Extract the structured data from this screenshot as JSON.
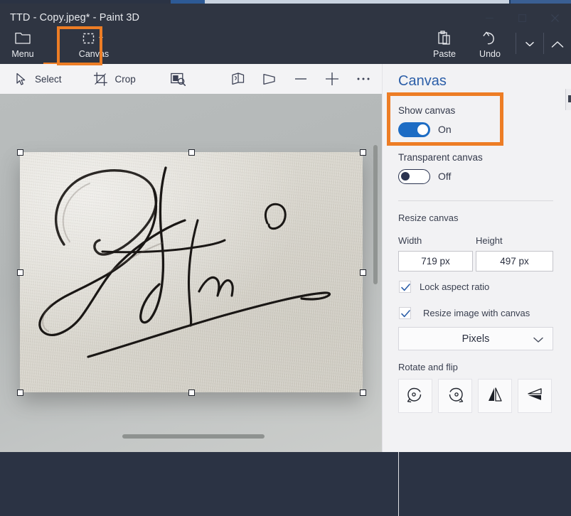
{
  "window": {
    "title": "TTD - Copy.jpeg* - Paint 3D",
    "minimize_label": "Minimize",
    "maximize_label": "Maximize",
    "close_label": "Close"
  },
  "ribbon": {
    "items": [
      {
        "label": "Menu",
        "icon": "folder-icon"
      },
      {
        "label": "Canvas",
        "icon": "canvas-icon",
        "highlighted": true,
        "has_dropdown": true
      }
    ],
    "right_items": [
      {
        "label": "Paste",
        "icon": "clipboard-icon"
      },
      {
        "label": "Undo",
        "icon": "undo-icon"
      }
    ],
    "more_label": "More options",
    "collapse_label": "Collapse ribbon",
    "highlight_color": "#ed7d25"
  },
  "toolbar": {
    "select_label": "Select",
    "crop_label": "Crop",
    "magic_select_label": "Magic select",
    "view3d_label": "3D view",
    "perspective_label": "Perspective",
    "zoom_out_label": "Zoom out",
    "zoom_in_label": "Zoom in",
    "more_label": "More"
  },
  "panel": {
    "title": "Canvas",
    "show_canvas": {
      "label": "Show canvas",
      "state": "On",
      "on": true
    },
    "transparent_canvas": {
      "label": "Transparent canvas",
      "state": "Off",
      "on": false
    },
    "resize": {
      "section_label": "Resize canvas",
      "width_label": "Width",
      "height_label": "Height",
      "width_value": "719 px",
      "height_value": "497 px",
      "lock_aspect_label": "Lock aspect ratio",
      "lock_aspect_checked": true,
      "resize_image_label": "Resize image with canvas",
      "resize_image_checked": true,
      "units_selected": "Pixels"
    },
    "rotate_flip": {
      "section_label": "Rotate and flip",
      "buttons": [
        {
          "label": "Rotate left",
          "icon": "rotate-left-icon"
        },
        {
          "label": "Rotate right",
          "icon": "rotate-right-icon"
        },
        {
          "label": "Flip horizontal",
          "icon": "flip-horizontal-icon"
        },
        {
          "label": "Flip vertical",
          "icon": "flip-vertical-icon"
        }
      ]
    },
    "accent_color": "#2b5ea8",
    "toggle_on_color": "#1d6cc4"
  },
  "canvas": {
    "content_description": "Handwritten ink signature on textured paper",
    "selected": true,
    "handle_count": 8
  }
}
